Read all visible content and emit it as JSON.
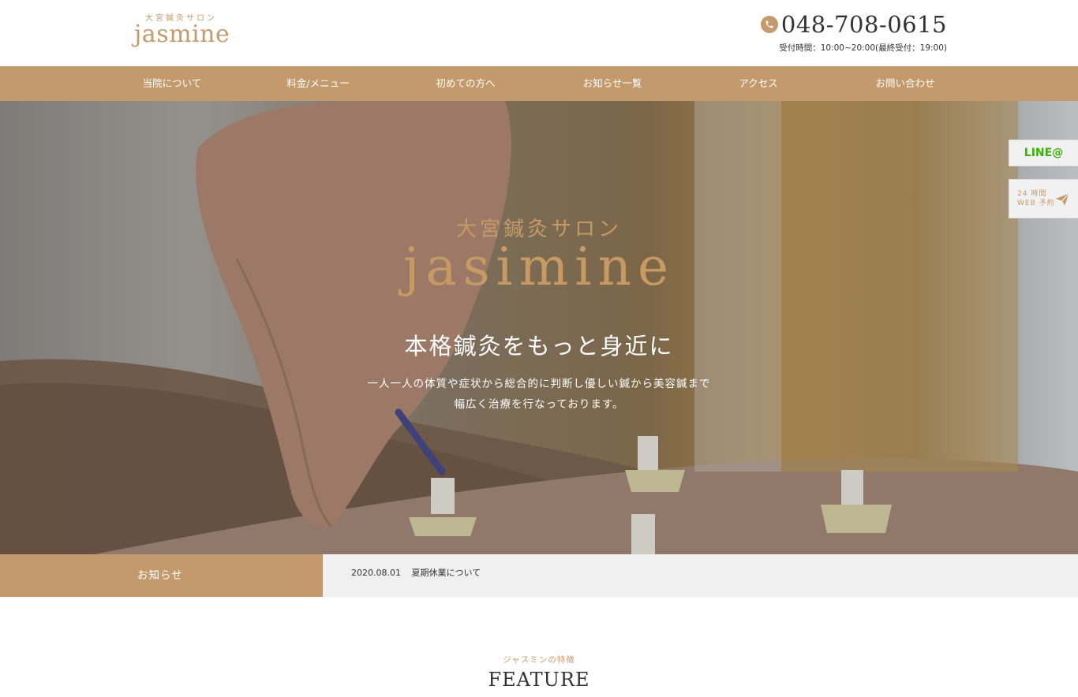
{
  "header": {
    "logo_sub": "大宮鍼灸サロン",
    "logo_main": "jasmine",
    "phone": "048-708-0615",
    "hours": "受付時間：10:00~20:00(最終受付：19:00)"
  },
  "nav": {
    "items": [
      {
        "label": "当院について"
      },
      {
        "label": "料金/メニュー"
      },
      {
        "label": "初めての方へ"
      },
      {
        "label": "お知らせ一覧"
      },
      {
        "label": "アクセス"
      },
      {
        "label": "お問い合わせ"
      }
    ]
  },
  "hero": {
    "subtitle": "大宮鍼灸サロン",
    "brand": "jasimine",
    "headline": "本格鍼灸をもっと身近に",
    "desc_line1": "一人一人の体質や症状から総合的に判断し優しい鍼から美容鍼まで",
    "desc_line2": "幅広く治療を行なっております。"
  },
  "side": {
    "line_label": "LINE@",
    "web_line1": "24 時間",
    "web_line2": "WEB 予約"
  },
  "news": {
    "label": "お知らせ",
    "date": "2020.08.01",
    "title": "夏期休業について"
  },
  "feature": {
    "subtitle": "ジャスミンの特徴",
    "title": "FEATURE"
  },
  "colors": {
    "accent": "#c49a6c",
    "line_green": "#35b400"
  },
  "icons": {
    "phone": "phone-icon",
    "web_reserve": "paper-plane-icon"
  }
}
